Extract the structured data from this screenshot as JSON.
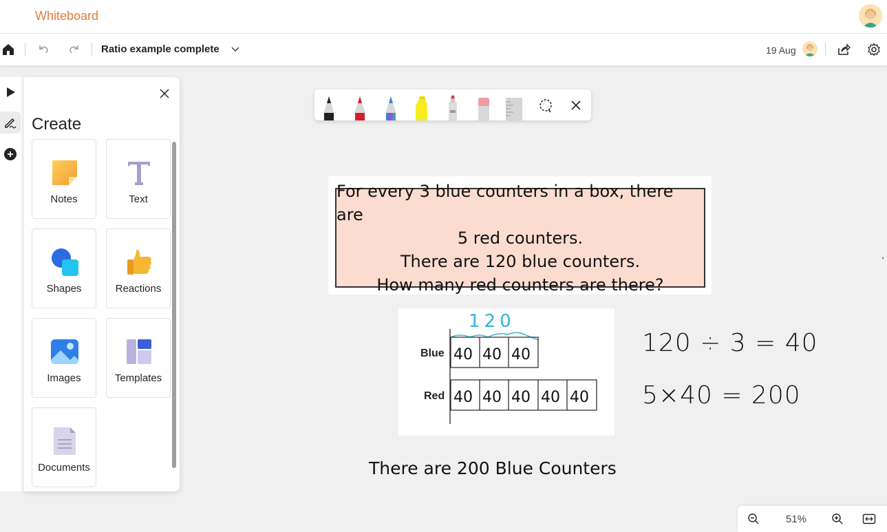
{
  "app": {
    "title": "Whiteboard"
  },
  "commandbar": {
    "board_title": "Ratio example complete",
    "date": "19 Aug"
  },
  "panel": {
    "title": "Create",
    "tiles": [
      {
        "label": "Notes",
        "icon": "sticky-note-icon"
      },
      {
        "label": "Text",
        "icon": "text-icon"
      },
      {
        "label": "Shapes",
        "icon": "shapes-icon"
      },
      {
        "label": "Reactions",
        "icon": "thumbs-up-icon"
      },
      {
        "label": "Images",
        "icon": "image-icon"
      },
      {
        "label": "Templates",
        "icon": "templates-icon"
      },
      {
        "label": "Documents",
        "icon": "document-icon"
      }
    ]
  },
  "inkbar": {
    "tools": [
      "black-pen-icon",
      "red-pen-icon",
      "rainbow-pen-icon",
      "highlighter-icon",
      "laser-pointer-icon",
      "eraser-icon",
      "ruler-icon",
      "lasso-select-icon",
      "close-icon"
    ]
  },
  "canvas": {
    "problem_lines": [
      "For every 3 blue counters in a box, there are",
      "5 red counters.",
      "There are 120 blue counters.",
      "How many red counters are there?"
    ],
    "bar_model": {
      "total_label": "120",
      "blue_label": "Blue",
      "red_label": "Red",
      "blue_cells": [
        "40",
        "40",
        "40"
      ],
      "red_cells": [
        "40",
        "40",
        "40",
        "40",
        "40"
      ]
    },
    "equation_1": "120 ÷ 3 = 40",
    "equation_2": "5×40 = 200",
    "answer": "There are 200 Blue Counters"
  },
  "zoom": {
    "level": "51%"
  },
  "colors": {
    "accent": "#e07a3f",
    "problem_fill": "#fcdccf",
    "ink_blue": "#33b5d9"
  }
}
